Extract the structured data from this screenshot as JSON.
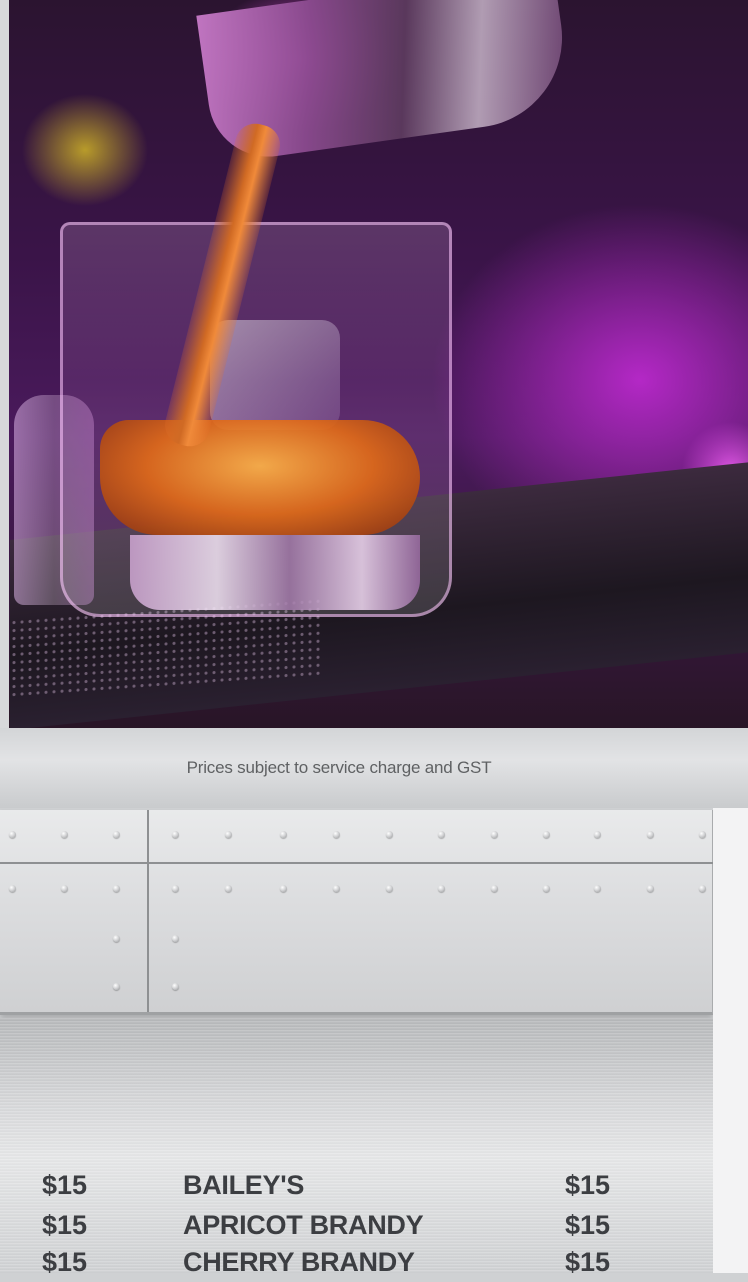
{
  "notice": "Prices subject to service charge and GST",
  "menu": {
    "rows": [
      {
        "left_price": "$15",
        "name": "BAILEY'S",
        "right_price": "$15"
      },
      {
        "left_price": "$15",
        "name": "APRICOT BRANDY",
        "right_price": "$15"
      },
      {
        "left_price": "$15",
        "name": "CHERRY BRANDY",
        "right_price": "$15"
      }
    ]
  },
  "photo": {
    "subject": "drink-poured-into-rocks-glass"
  },
  "colors": {
    "accent_purple": "#b428c6",
    "liquor_amber": "#e06a18",
    "text_dark": "#3c3e42",
    "notice_text": "#5f6163"
  }
}
